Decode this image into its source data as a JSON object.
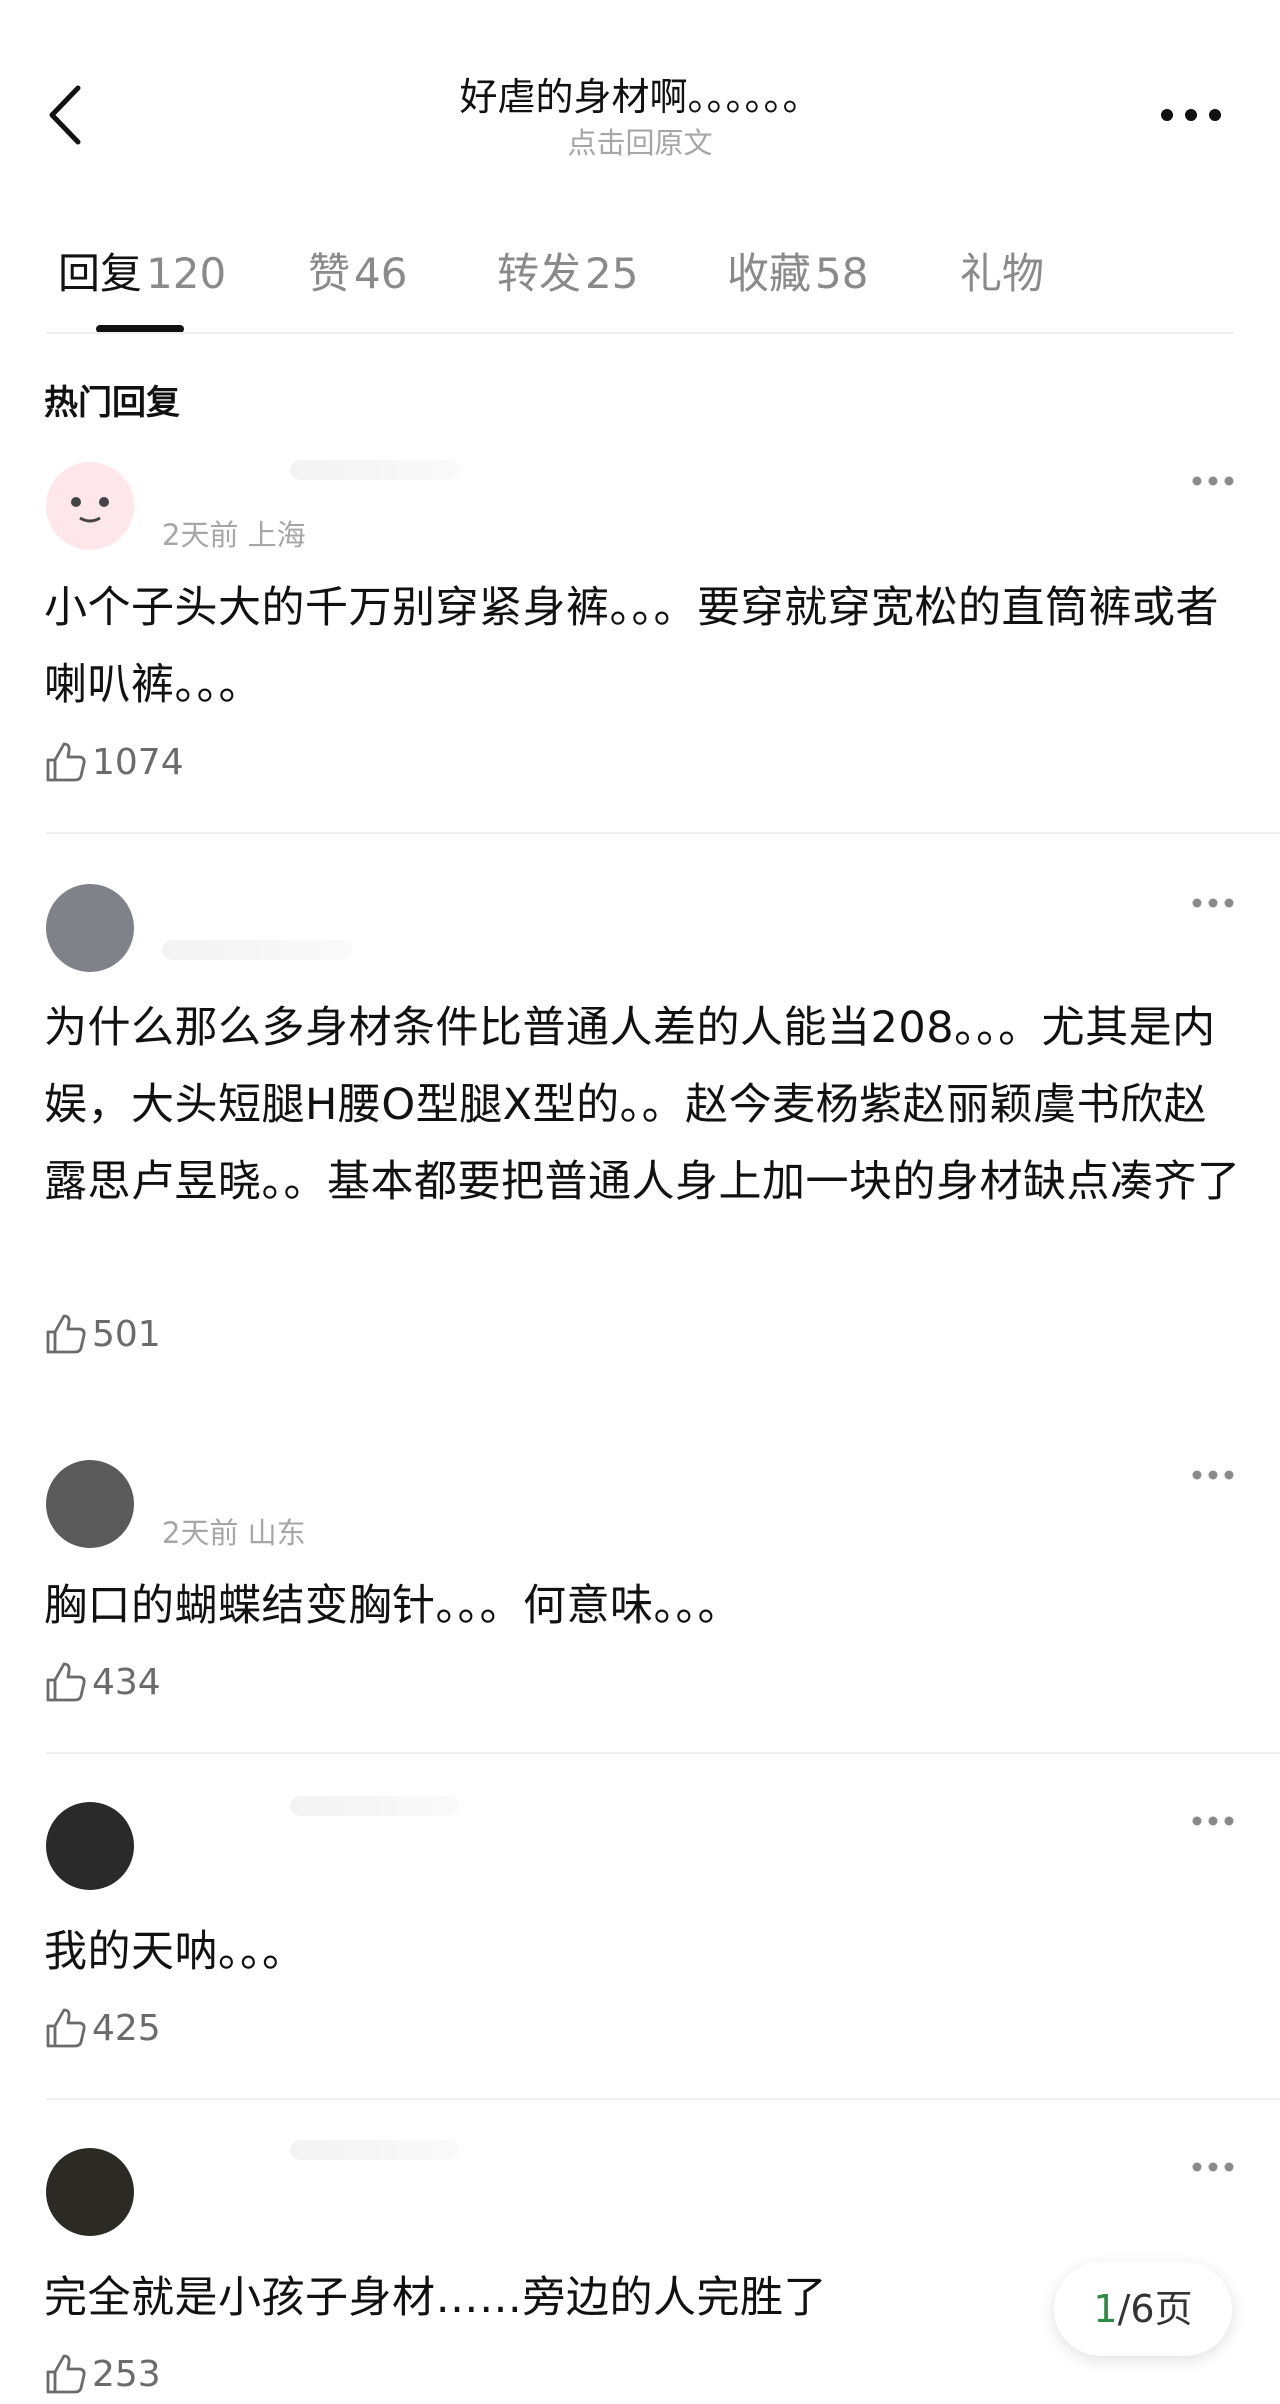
{
  "header": {
    "title": "好虐的身材啊。。。。。。",
    "subtitle": "点击回原文"
  },
  "tabs": [
    {
      "label": "回复",
      "count": "120",
      "active": true
    },
    {
      "label": "赞",
      "count": "46"
    },
    {
      "label": "转发",
      "count": "25"
    },
    {
      "label": "收藏",
      "count": "58"
    },
    {
      "label": "礼物",
      "count": ""
    }
  ],
  "section_title": "热门回复",
  "comments": [
    {
      "meta": "2天前 上海",
      "text": "小个子头大的千万别穿紧身裤。。。要穿就穿宽松的直筒裤或者喇叭裤。。。",
      "likes": "1074"
    },
    {
      "meta": "",
      "text": "为什么那么多身材条件比普通人差的人能当208。。。尤其是内娱，大头短腿H腰O型腿X型的。。赵今麦杨紫赵丽颖虞书欣赵露思卢昱晓。。基本都要把普通人身上加一块的身材缺点凑齐了",
      "likes": "501"
    },
    {
      "meta": "2天前 山东",
      "text": "胸口的蝴蝶结变胸针。。。何意味。。。",
      "likes": "434"
    },
    {
      "meta": "",
      "text": "我的天呐。。。",
      "likes": "425"
    },
    {
      "meta": "",
      "text": "完全就是小孩子身材……旁边的人完胜了",
      "likes": "253"
    }
  ],
  "pager": {
    "current": "1",
    "total": "/6页"
  },
  "colors": {
    "accent_green": "#2e8b45",
    "text_primary": "#111111",
    "text_secondary": "#a6a6a6"
  },
  "icons": [
    "back-chevron-icon",
    "more-dots-icon",
    "thumbs-up-icon"
  ]
}
